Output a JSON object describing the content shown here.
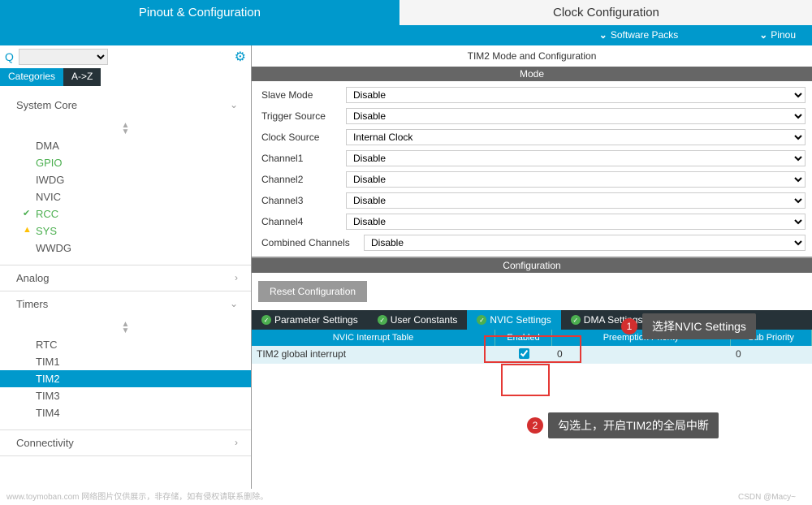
{
  "topTabs": {
    "pinout": "Pinout & Configuration",
    "clock": "Clock Configuration"
  },
  "subHeader": {
    "softwarePacks": "Software Packs",
    "pinout": "Pinou"
  },
  "search": {
    "placeholder": ""
  },
  "catTabs": {
    "categories": "Categories",
    "az": "A->Z"
  },
  "tree": {
    "systemCore": {
      "label": "System Core",
      "items": [
        "DMA",
        "GPIO",
        "IWDG",
        "NVIC",
        "RCC",
        "SYS",
        "WWDG"
      ]
    },
    "analog": {
      "label": "Analog"
    },
    "timers": {
      "label": "Timers",
      "items": [
        "RTC",
        "TIM1",
        "TIM2",
        "TIM3",
        "TIM4"
      ]
    },
    "connectivity": {
      "label": "Connectivity"
    }
  },
  "rightTitle": "TIM2 Mode and Configuration",
  "sections": {
    "mode": "Mode",
    "configuration": "Configuration"
  },
  "mode": {
    "rows": [
      {
        "label": "Slave Mode",
        "value": "Disable"
      },
      {
        "label": "Trigger Source",
        "value": "Disable"
      },
      {
        "label": "Clock Source",
        "value": "Internal Clock"
      },
      {
        "label": "Channel1",
        "value": "Disable"
      },
      {
        "label": "Channel2",
        "value": "Disable"
      },
      {
        "label": "Channel3",
        "value": "Disable"
      },
      {
        "label": "Channel4",
        "value": "Disable"
      },
      {
        "label": "Combined Channels",
        "value": "Disable"
      }
    ]
  },
  "resetBtn": "Reset Configuration",
  "configTabs": [
    "Parameter Settings",
    "User Constants",
    "NVIC Settings",
    "DMA Settings"
  ],
  "nvic": {
    "headers": {
      "name": "NVIC Interrupt Table",
      "enabled": "Enabled",
      "preempt": "Preemption Priority",
      "sub": "Sub Priority"
    },
    "rows": [
      {
        "name": "TIM2 global interrupt",
        "enabled": true,
        "preempt": "0",
        "sub": "0"
      }
    ]
  },
  "annotations": {
    "a1": "选择NVIC Settings",
    "a2": "勾选上，开启TIM2的全局中断"
  },
  "footer": {
    "left": "www.toymoban.com 网络图片仅供展示，非存储，如有侵权请联系删除。",
    "right": "CSDN @Macy~"
  }
}
